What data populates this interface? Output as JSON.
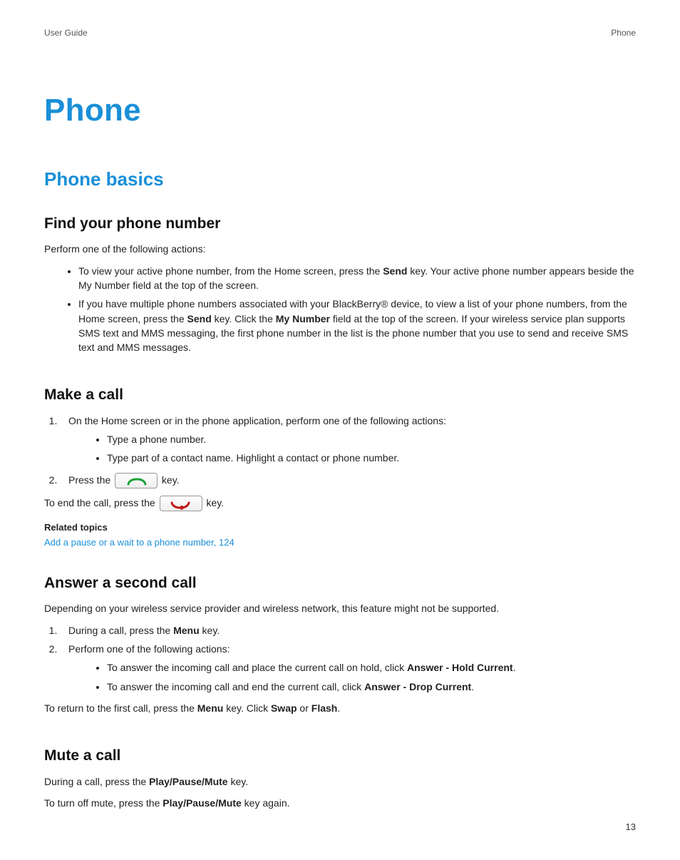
{
  "header": {
    "left": "User Guide",
    "right": "Phone"
  },
  "title": "Phone",
  "section": "Phone basics",
  "sub1": {
    "heading": "Find your phone number",
    "intro": "Perform one of the following actions:",
    "b1a": "To view your active phone number, from the Home screen, press the ",
    "b1b_bold": "Send",
    "b1c": " key. Your active phone number appears beside the My Number field at the top of the screen.",
    "b2a": "If you have multiple phone numbers associated with your BlackBerry® device, to view a list of your phone numbers, from the Home screen, press the ",
    "b2b_bold": "Send",
    "b2c": " key. Click the ",
    "b2d_bold": "My Number",
    "b2e": " field at the top of the screen. If your wireless service plan supports SMS text and MMS messaging, the first phone number in the list is the phone number that you use to send and receive SMS text and MMS messages."
  },
  "sub2": {
    "heading": "Make a call",
    "step1": "On the Home screen or in the phone application, perform one of the following actions:",
    "step1_b1": "Type a phone number.",
    "step1_b2": "Type part of a contact name. Highlight a contact or phone number.",
    "step2_pre": "Press the ",
    "step2_post": " key.",
    "end_pre": "To end the call, press the ",
    "end_post": " key.",
    "related_head": "Related topics",
    "related_link": "Add a pause or a wait to a phone number, 124"
  },
  "sub3": {
    "heading": "Answer a second call",
    "note": "Depending on your wireless service provider and wireless network, this feature might not be supported.",
    "s1a": "During a call, press the ",
    "s1b_bold": "Menu",
    "s1c": " key.",
    "s2": "Perform one of the following actions:",
    "s2_b1a": "To answer the incoming call and place the current call on hold, click ",
    "s2_b1b_bold": "Answer - Hold Current",
    "s2_b1c": ".",
    "s2_b2a": "To answer the incoming call and end the current call, click ",
    "s2_b2b_bold": "Answer - Drop Current",
    "s2_b2c": ".",
    "ret_a": "To return to the first call, press the ",
    "ret_b_bold": "Menu",
    "ret_c": " key. Click ",
    "ret_d_bold": "Swap",
    "ret_e": " or ",
    "ret_f_bold": "Flash",
    "ret_g": "."
  },
  "sub4": {
    "heading": "Mute a call",
    "l1a": "During a call, press the ",
    "l1b_bold": "Play/Pause/Mute",
    "l1c": " key.",
    "l2a": "To turn off mute, press the ",
    "l2b_bold": "Play/Pause/Mute",
    "l2c": " key again."
  },
  "page_number": "13"
}
